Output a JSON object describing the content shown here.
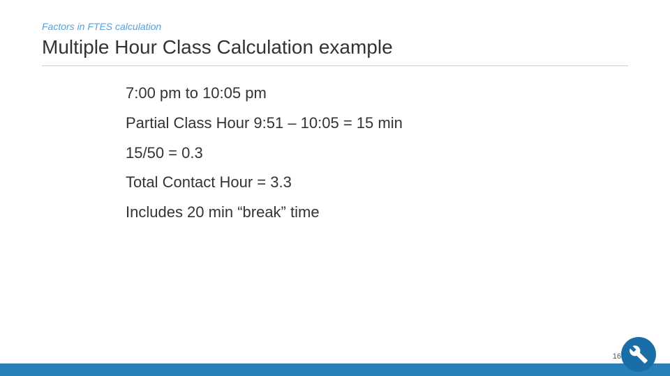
{
  "slide": {
    "subtitle": "Factors in FTES calculation",
    "title": "Multiple Hour Class Calculation example",
    "bullets": [
      "7:00 pm to 10:05 pm",
      "Partial Class Hour 9:51 – 10:05 = 15 min",
      "15/50 = 0.3",
      "Total Contact Hour = 3.3",
      "Includes 20 min “break” time"
    ],
    "page_number": "16",
    "accent_color": "#2980b9"
  }
}
